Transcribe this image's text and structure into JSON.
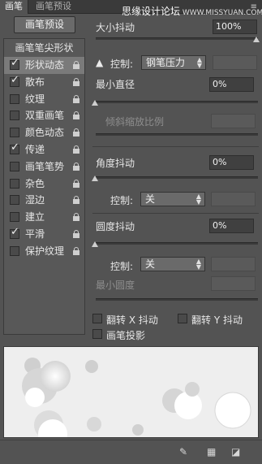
{
  "tabs": {
    "active": "画笔",
    "inactive": "画笔预设"
  },
  "watermark": {
    "main": "思缘设计论坛",
    "sub": " WWW.MISSYUAN.COM"
  },
  "panel_menu_icon": "panel-menu-icon",
  "preset_button": "画笔预设",
  "sidebar": {
    "header": "画笔笔尖形状",
    "items": [
      {
        "label": "形状动态",
        "checked": true
      },
      {
        "label": "散布",
        "checked": true
      },
      {
        "label": "纹理",
        "checked": false
      },
      {
        "label": "双重画笔",
        "checked": false
      },
      {
        "label": "颜色动态",
        "checked": false
      },
      {
        "label": "传递",
        "checked": true
      },
      {
        "label": "画笔笔势",
        "checked": false
      },
      {
        "label": "杂色",
        "checked": false
      },
      {
        "label": "湿边",
        "checked": false
      },
      {
        "label": "建立",
        "checked": false
      },
      {
        "label": "平滑",
        "checked": true
      },
      {
        "label": "保护纹理",
        "checked": false
      }
    ]
  },
  "settings": {
    "size_jitter": {
      "label": "大小抖动",
      "value": "100%",
      "level": 1.0
    },
    "control1": {
      "label": "控制:",
      "value": "钢笔压力"
    },
    "min_diameter": {
      "label": "最小直径",
      "value": "0%",
      "level": 0.0
    },
    "tilt_scale": {
      "label": "倾斜缩放比例"
    },
    "angle_jitter": {
      "label": "角度抖动",
      "value": "0%",
      "level": 0.0
    },
    "control2": {
      "label": "控制:",
      "value": "关"
    },
    "roundness_jitter": {
      "label": "圆度抖动",
      "value": "0%",
      "level": 0.0
    },
    "control3": {
      "label": "控制:",
      "value": "关"
    },
    "min_roundness": {
      "label": "最小圆度"
    },
    "flip_x": {
      "label": "翻转 X 抖动"
    },
    "flip_y": {
      "label": "翻转 Y 抖动"
    },
    "brush_projection": {
      "label": "画笔投影"
    }
  },
  "bottom_icons": [
    "brush-toggle-icon",
    "grid-icon",
    "new-preset-icon"
  ]
}
